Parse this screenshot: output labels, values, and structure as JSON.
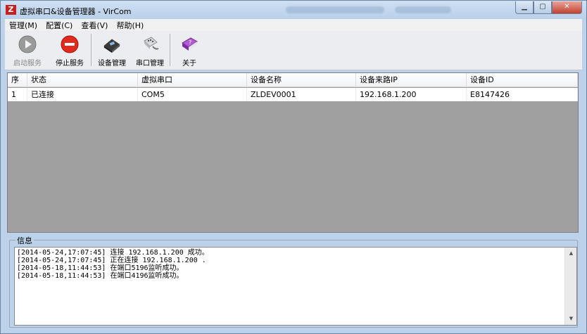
{
  "window": {
    "title": "虚拟串口&设备管理器 - VirCom",
    "icon_text": "Z"
  },
  "menu": [
    {
      "label": "管理(M)"
    },
    {
      "label": "配置(C)"
    },
    {
      "label": "查看(V)"
    },
    {
      "label": "帮助(H)"
    }
  ],
  "toolbar": {
    "start_label": "启动服务",
    "stop_label": "停止服务",
    "device_label": "设备管理",
    "serial_label": "串口管理",
    "about_label": "关于"
  },
  "table": {
    "columns": [
      "序",
      "状态",
      "虚拟串口",
      "设备名称",
      "设备来路IP",
      "设备ID"
    ],
    "rows": [
      [
        "1",
        "已连接",
        "COM5",
        "ZLDEV0001",
        "192.168.1.200",
        "E8147426"
      ]
    ]
  },
  "info": {
    "caption": "信息",
    "log": [
      "[2014-05-24,17:07:45] 连接 192.168.1.200 成功。",
      "[2014-05-24,17:07:45] 正在连接 192.168.1.200 .",
      "[2014-05-18,11:44:53] 在端口5196监听成功。",
      "[2014-05-18,11:44:53] 在端口4196监听成功。"
    ]
  },
  "colors": {
    "frame": "#bcd2ea",
    "table_bg": "#a0a0a0",
    "close": "#c2412d",
    "app_icon": "#c8201f"
  }
}
